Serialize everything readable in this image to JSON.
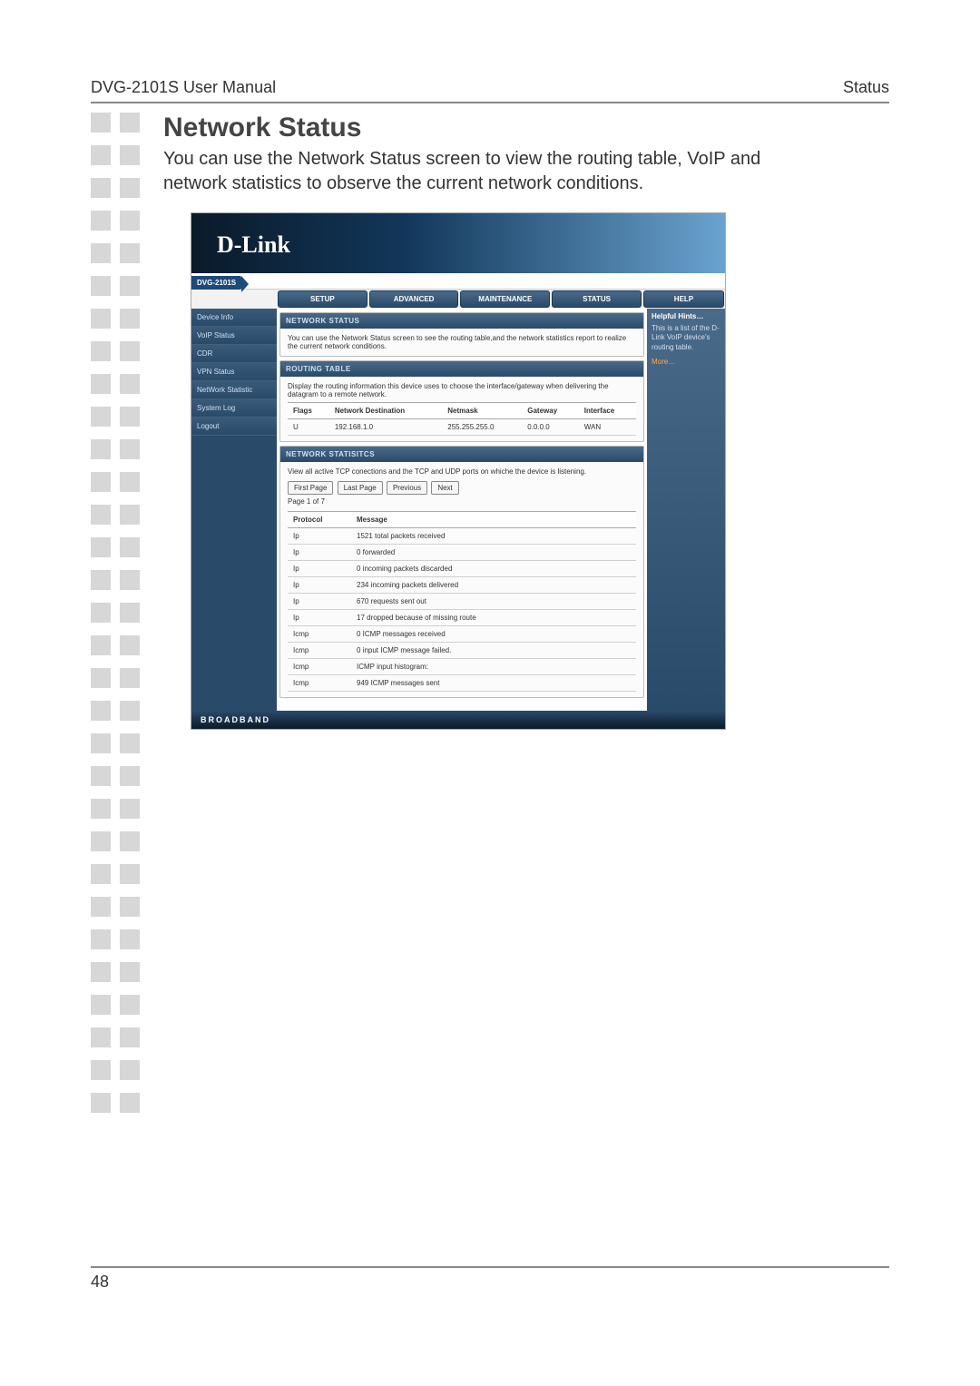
{
  "header": {
    "left": "DVG-2101S User Manual",
    "right": "Status"
  },
  "title": "Network Status",
  "intro": "You can use the Network Status screen to view the routing table, VoIP and network statistics to observe the current network conditions.",
  "page_number": "48",
  "brand": "D-Link",
  "model_tab": "DVG-2101S",
  "nav": [
    "SETUP",
    "ADVANCED",
    "MAINTENANCE",
    "STATUS",
    "HELP"
  ],
  "sidebar": {
    "items": [
      {
        "label": "Device Info"
      },
      {
        "label": "VoIP Status"
      },
      {
        "label": "CDR"
      },
      {
        "label": "VPN Status"
      },
      {
        "label": "NetWork Statistic"
      },
      {
        "label": "System Log"
      },
      {
        "label": "Logout"
      }
    ]
  },
  "panels": {
    "network_status": {
      "heading": "NETWORK STATUS",
      "text": "You can use the Network Status screen to see the routing table,and the network statistics report to realize the current network conditions."
    },
    "routing_table": {
      "heading": "ROUTING TABLE",
      "text": "Display the routing information this device uses to choose the interface/gateway when delivering the datagram to a remote network.",
      "columns": [
        "Flags",
        "Network Destination",
        "Netmask",
        "Gateway",
        "Interface"
      ],
      "rows": [
        [
          "U",
          "192.168.1.0",
          "255.255.255.0",
          "0.0.0.0",
          "WAN"
        ]
      ]
    },
    "network_statistics": {
      "heading": "NETWORK STATISITCS",
      "text": "View all active TCP conections and the TCP and UDP ports on whiche the device is listening.",
      "pager": {
        "first": "First Page",
        "last": "Last Page",
        "prev": "Previous",
        "next": "Next",
        "info": "Page 1 of 7"
      },
      "columns": [
        "Protocol",
        "Message"
      ],
      "rows": [
        [
          "Ip",
          "1521 total packets received"
        ],
        [
          "Ip",
          "0 forwarded"
        ],
        [
          "Ip",
          "0 incoming packets discarded"
        ],
        [
          "Ip",
          "234 incoming packets delivered"
        ],
        [
          "Ip",
          "670 requests sent out"
        ],
        [
          "Ip",
          "17 dropped because of missing route"
        ],
        [
          "Icmp",
          "0 ICMP messages received"
        ],
        [
          "Icmp",
          "0 input ICMP message failed."
        ],
        [
          "Icmp",
          "ICMP input histogram:"
        ],
        [
          "Icmp",
          "949 ICMP messages sent"
        ]
      ]
    }
  },
  "help": {
    "heading": "Helpful Hints…",
    "text": "This is a list of the D-Link VoIP device's routing table.",
    "more": "More…"
  },
  "footer_bar": "BROADBAND"
}
